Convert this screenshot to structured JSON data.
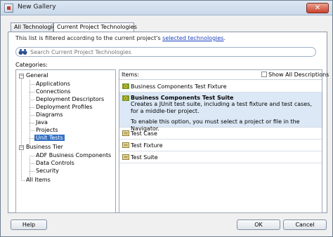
{
  "window": {
    "title": "New Gallery",
    "close_symbol": "✕"
  },
  "tabs": [
    {
      "label": "All Technologies",
      "active": false
    },
    {
      "label": "Current Project Technologies",
      "active": true
    }
  ],
  "filter": {
    "prefix": "This list is filtered according to the current project's ",
    "link": "selected technologies",
    "suffix": "."
  },
  "search": {
    "placeholder": "Search Current Project Technologies"
  },
  "categories": {
    "label": "Categories:",
    "tree": [
      {
        "label": "General",
        "level": 0,
        "expandable": true
      },
      {
        "label": "Applications",
        "level": 1
      },
      {
        "label": "Connections",
        "level": 1
      },
      {
        "label": "Deployment Descriptors",
        "level": 1
      },
      {
        "label": "Deployment Profiles",
        "level": 1
      },
      {
        "label": "Diagrams",
        "level": 1
      },
      {
        "label": "Java",
        "level": 1
      },
      {
        "label": "Projects",
        "level": 1
      },
      {
        "label": "Unit Tests",
        "level": 1,
        "selected": true
      },
      {
        "label": "Business Tier",
        "level": 0,
        "expandable": true
      },
      {
        "label": "ADF Business Components",
        "level": 1
      },
      {
        "label": "Data Controls",
        "level": 1
      },
      {
        "label": "Security",
        "level": 1
      },
      {
        "label": "All Items",
        "level": 0
      }
    ]
  },
  "items": {
    "label": "Items:",
    "show_all_label": "Show All Descriptions",
    "show_all_checked": false,
    "list": [
      {
        "title": "Business Components Test Fixture",
        "icon": "gear-icon"
      },
      {
        "title": "Business Components Test Suite",
        "icon": "gear-icon",
        "selected": true,
        "description": "Creates a JUnit test suite, including a test fixture and test cases, for a middle-tier project.",
        "note": "To enable this option, you must select a project or file in the Navigator."
      },
      {
        "title": "Test Case",
        "icon": "document-icon"
      },
      {
        "title": "Test Fixture",
        "icon": "document-icon"
      },
      {
        "title": "Test Suite",
        "icon": "document-icon"
      }
    ]
  },
  "buttons": {
    "help": "Help",
    "ok": "OK",
    "cancel": "Cancel"
  }
}
